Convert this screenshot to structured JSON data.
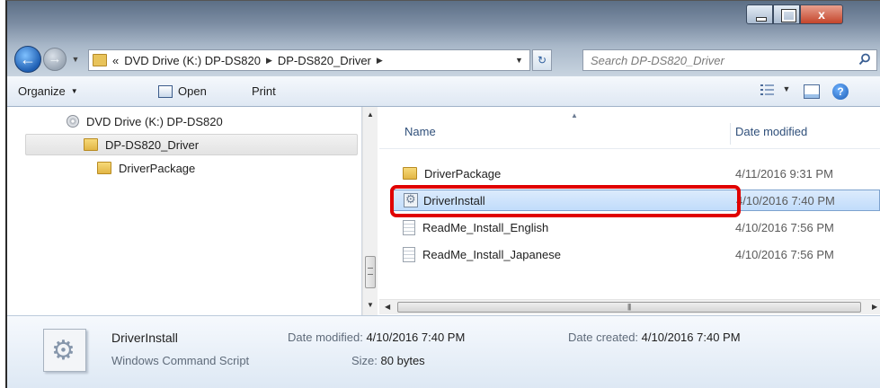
{
  "window": {
    "close_glyph": "x"
  },
  "address": {
    "overflow_glyph": "«",
    "segments": [
      "DVD Drive (K:) DP-DS820",
      "DP-DS820_Driver"
    ]
  },
  "search": {
    "placeholder": "Search DP-DS820_Driver"
  },
  "toolbar": {
    "organize_label": "Organize",
    "open_label": "Open",
    "print_label": "Print",
    "help_glyph": "?"
  },
  "navpane": {
    "items": [
      {
        "label": "DVD Drive (K:) DP-DS820",
        "icon": "dvd-drive-icon"
      },
      {
        "label": "DP-DS820_Driver",
        "icon": "folder-icon",
        "selected": true
      },
      {
        "label": "DriverPackage",
        "icon": "folder-icon"
      }
    ]
  },
  "filelist": {
    "columns": {
      "name": "Name",
      "date": "Date modified"
    },
    "rows": [
      {
        "name": "DriverPackage",
        "date": "4/11/2016 9:31 PM",
        "icon": "folder-icon"
      },
      {
        "name": "DriverInstall",
        "date": "4/10/2016 7:40 PM",
        "icon": "script-icon",
        "selected": true
      },
      {
        "name": "ReadMe_Install_English",
        "date": "4/10/2016 7:56 PM",
        "icon": "text-file-icon"
      },
      {
        "name": "ReadMe_Install_Japanese",
        "date": "4/10/2016 7:56 PM",
        "icon": "text-file-icon"
      }
    ]
  },
  "details": {
    "name": "DriverInstall",
    "type": "Windows Command Script",
    "modified_label": "Date modified:",
    "modified_value": "4/10/2016 7:40 PM",
    "size_label": "Size:",
    "size_value": "80 bytes",
    "created_label": "Date created:",
    "created_value": "4/10/2016 7:40 PM"
  },
  "colors": {
    "highlight_frame": "#e00000",
    "selection": "#c1dcfb"
  }
}
